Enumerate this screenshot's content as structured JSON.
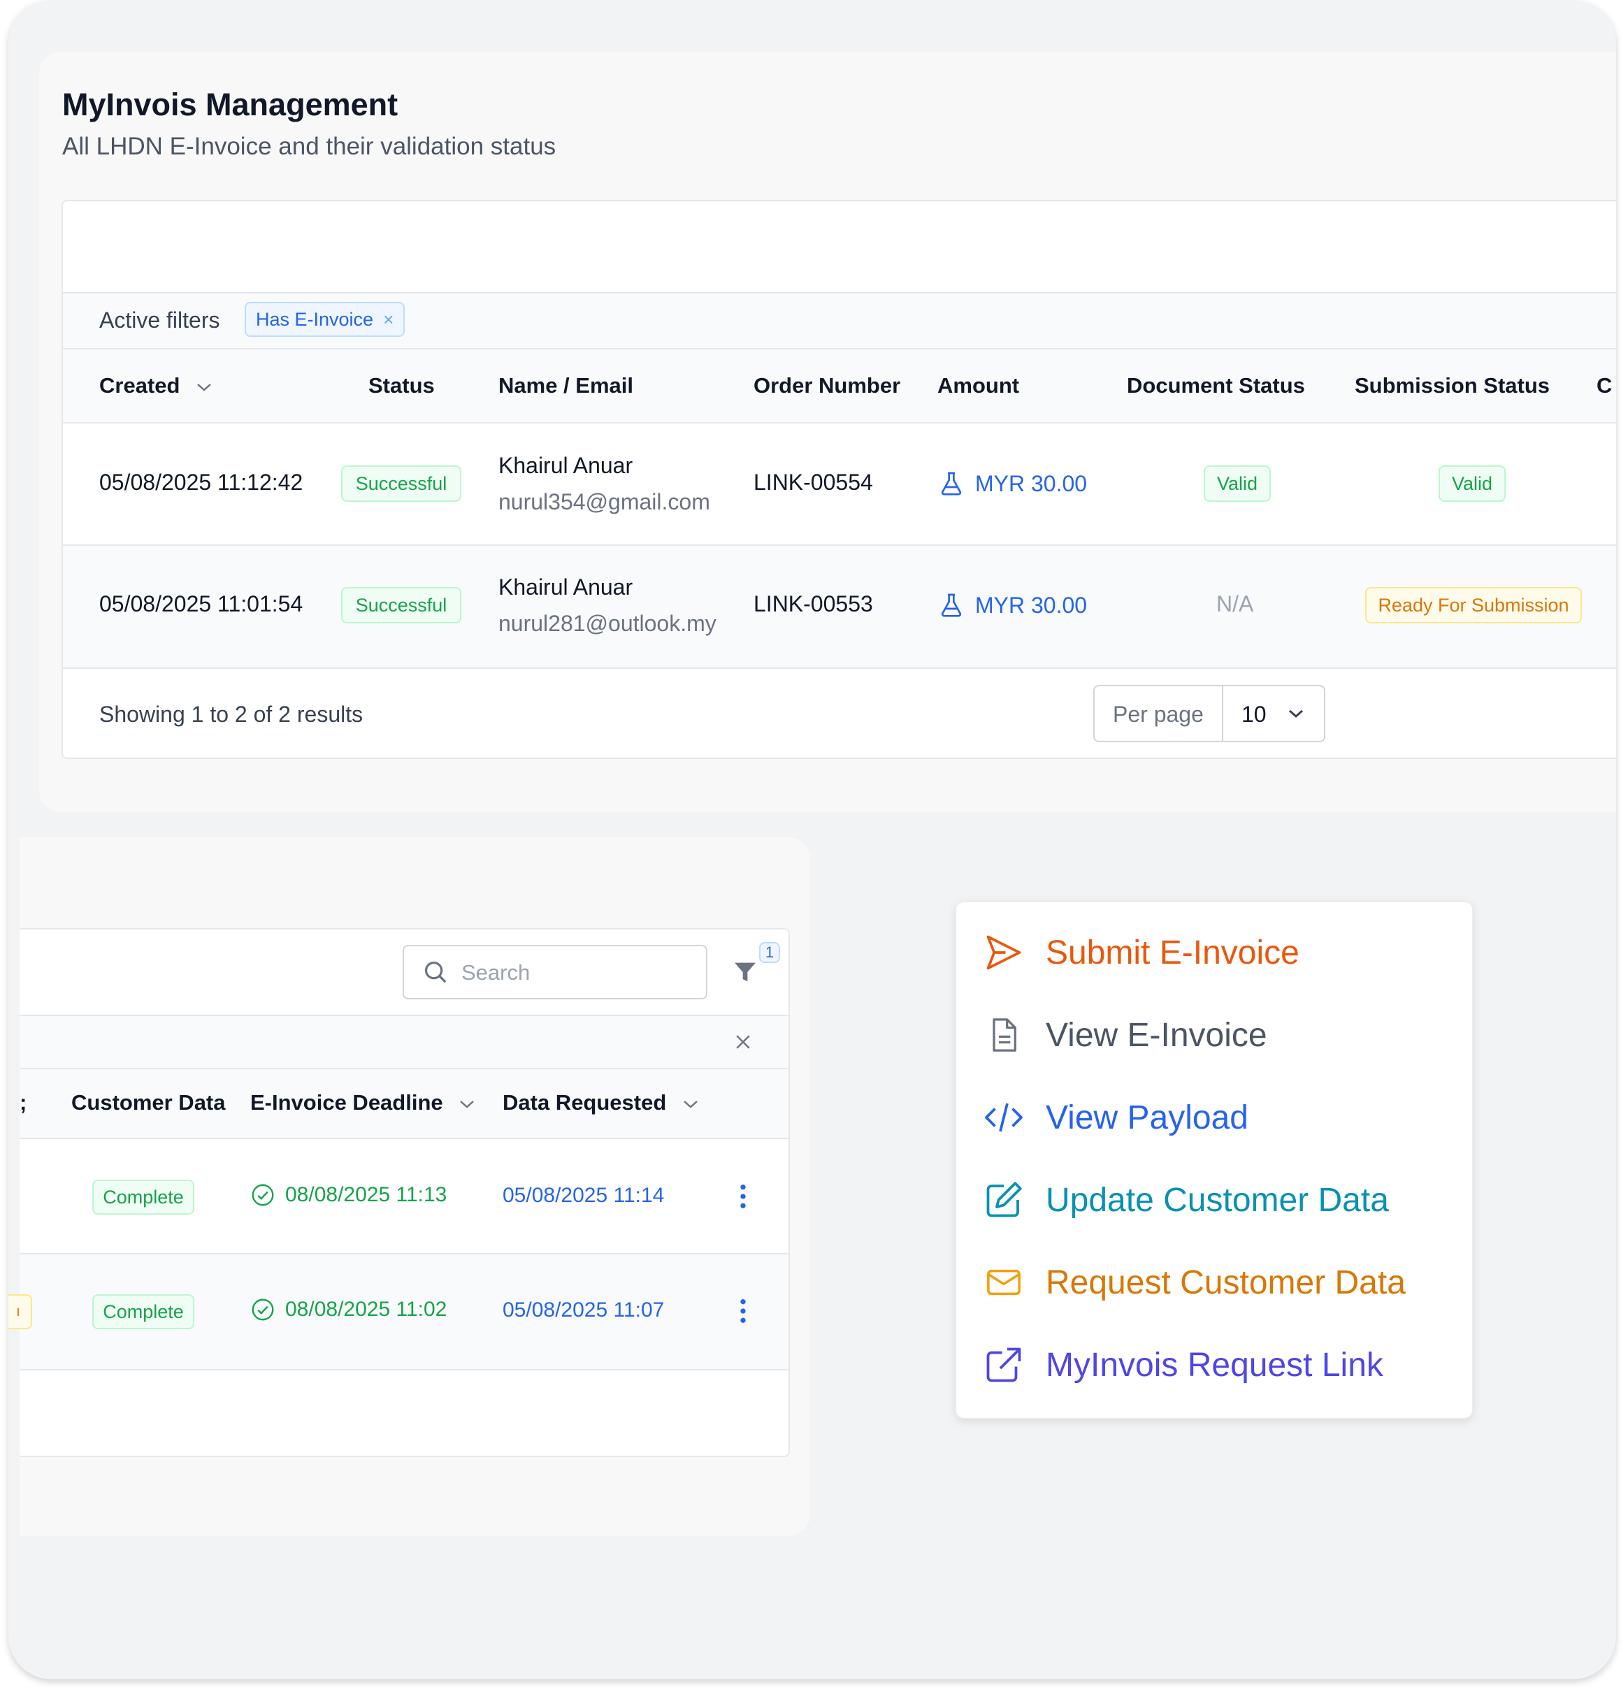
{
  "page": {
    "title": "MyInvois Management",
    "subtitle": "All LHDN E-Invoice and their validation status"
  },
  "filters": {
    "label": "Active filters",
    "chip": "Has E-Invoice"
  },
  "table1": {
    "headers": {
      "created": "Created",
      "status": "Status",
      "name": "Name / Email",
      "order": "Order Number",
      "amount": "Amount",
      "doc_status": "Document Status",
      "sub_status": "Submission Status",
      "cut": "C"
    },
    "rows": [
      {
        "created": "05/08/2025 11:12:42",
        "status": "Successful",
        "name": "Khairul Anuar",
        "email": "nurul354@gmail.com",
        "order": "LINK-00554",
        "amount": "MYR 30.00",
        "doc_status": "Valid",
        "sub_status": "Valid"
      },
      {
        "created": "05/08/2025 11:01:54",
        "status": "Successful",
        "name": "Khairul Anuar",
        "email": "nurul281@outlook.my",
        "order": "LINK-00553",
        "amount": "MYR 30.00",
        "doc_status": "N/A",
        "sub_status": "Ready For Submission"
      }
    ],
    "footer": {
      "showing": "Showing 1 to 2 of 2 results",
      "per_page_label": "Per page",
      "per_page_value": "10"
    }
  },
  "table2": {
    "search_placeholder": "Search",
    "filter_count": "1",
    "headers": {
      "customer_data": "Customer Data",
      "deadline": "E-Invoice Deadline",
      "requested": "Data Requested"
    },
    "rows": [
      {
        "customer_data": "Complete",
        "deadline": "08/08/2025 11:13",
        "requested": "05/08/2025 11:14"
      },
      {
        "customer_data": "Complete",
        "deadline": "08/08/2025 11:02",
        "requested": "05/08/2025 11:07"
      }
    ]
  },
  "menu": {
    "items": [
      {
        "label": "Submit E-Invoice",
        "icon": "send-icon",
        "color": "#ea580c"
      },
      {
        "label": "View E-Invoice",
        "icon": "document-icon",
        "color": "#4b5563"
      },
      {
        "label": "View Payload",
        "icon": "code-icon",
        "color": "#2563eb"
      },
      {
        "label": "Update Customer Data",
        "icon": "edit-icon",
        "color": "#0891b2"
      },
      {
        "label": "Request Customer Data",
        "icon": "mail-icon",
        "color": "#d97706"
      },
      {
        "label": "MyInvois Request Link",
        "icon": "external-link-icon",
        "color": "#4f46e5"
      }
    ]
  },
  "colors": {
    "accent_blue": "#2563eb",
    "success_green": "#16a34a",
    "warning_amber": "#d97706"
  }
}
